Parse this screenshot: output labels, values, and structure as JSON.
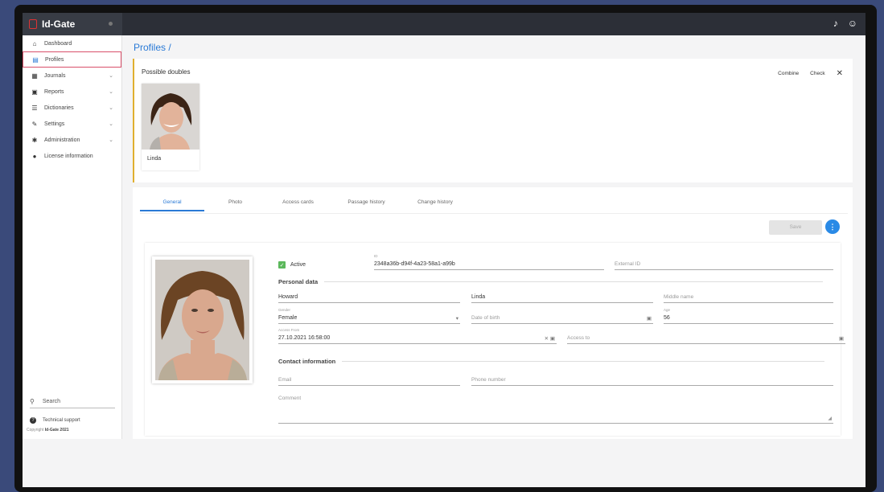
{
  "app": {
    "name": "Id-Gate"
  },
  "sidebar": {
    "items": [
      {
        "label": "Dashboard",
        "icon": "home-icon",
        "glyph": "⌂",
        "chevron": ""
      },
      {
        "label": "Profiles",
        "icon": "id-card-icon",
        "glyph": "▤",
        "chevron": ""
      },
      {
        "label": "Journals",
        "icon": "table-icon",
        "glyph": "▦",
        "chevron": "⌄"
      },
      {
        "label": "Reports",
        "icon": "document-icon",
        "glyph": "▣",
        "chevron": "⌄"
      },
      {
        "label": "Dictionaries",
        "icon": "list-icon",
        "glyph": "☰",
        "chevron": "⌄"
      },
      {
        "label": "Settings",
        "icon": "wrench-icon",
        "glyph": "✎",
        "chevron": "⌄"
      },
      {
        "label": "Administration",
        "icon": "gear-icon",
        "glyph": "✱",
        "chevron": "⌄"
      },
      {
        "label": "License information",
        "icon": "user-icon",
        "glyph": "●",
        "chevron": ""
      }
    ],
    "search": {
      "label": "Search",
      "glyph": "⚲"
    },
    "support": {
      "label": "Technical support",
      "glyph": "?"
    },
    "copyright": {
      "prefix": "Copyright ",
      "brand": "Id-Gate 2021"
    }
  },
  "topbar": {
    "bell_glyph": "♪",
    "user_glyph": "☺"
  },
  "page": {
    "title": "Profiles /"
  },
  "doubles": {
    "title": "Possible doubles",
    "combine_label": "Combine",
    "check_label": "Check",
    "close_glyph": "✕",
    "items": [
      {
        "name": "Linda"
      }
    ]
  },
  "tabs": [
    "General",
    "Photo",
    "Access cards",
    "Passage history",
    "Change history"
  ],
  "toolbar": {
    "save_label": "Save",
    "more_glyph": "⋮"
  },
  "form": {
    "active_label": "Active",
    "active_checked": true,
    "id_label": "ID",
    "id_value": "2348a36b-d94f-4a23-58a1-a99b",
    "external_id_placeholder": "External ID",
    "personal_data_title": "Personal data",
    "last_name": "Howard",
    "first_name": "Linda",
    "middle_name_placeholder": "Middle name",
    "gender_label": "Gender",
    "gender_value": "Female",
    "dob_placeholder": "Date of birth",
    "age_label": "Age",
    "age_value": "56",
    "access_from_label": "Access From",
    "access_from_value": "27.10.2021 16:58:00",
    "access_to_placeholder": "Access to",
    "contact_title": "Contact information",
    "email_placeholder": "Email",
    "phone_placeholder": "Phone number",
    "comment_placeholder": "Comment"
  },
  "colors": {
    "accent": "#2a7ad6",
    "highlight_border": "#d9506a",
    "warning_border": "#e0b030",
    "active_green": "#5cb85c"
  }
}
